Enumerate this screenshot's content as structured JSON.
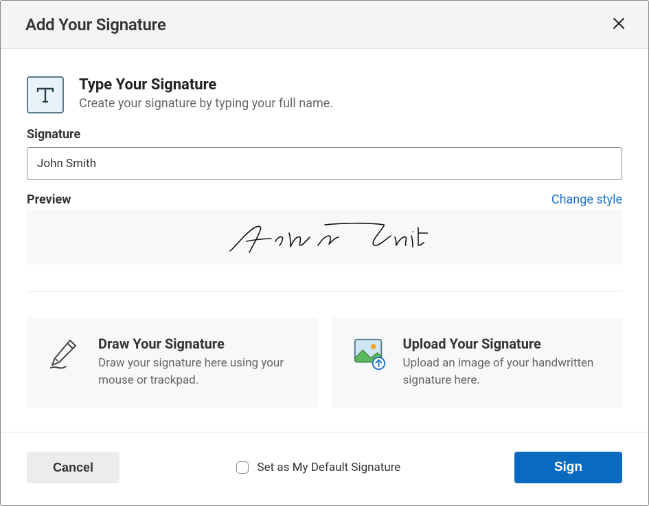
{
  "modal": {
    "title": "Add Your Signature"
  },
  "type_section": {
    "title": "Type Your Signature",
    "subtitle": "Create your signature by typing your full name.",
    "input_label": "Signature",
    "input_value": "John Smith",
    "preview_label": "Preview",
    "change_style_label": "Change style",
    "preview_text": "John Smith"
  },
  "draw_option": {
    "title": "Draw Your Signature",
    "subtitle": "Draw your signature here using your mouse or trackpad."
  },
  "upload_option": {
    "title": "Upload Your Signature",
    "subtitle": "Upload an image of your handwritten signature here."
  },
  "footer": {
    "cancel_label": "Cancel",
    "default_label": "Set as My Default Signature",
    "sign_label": "Sign"
  }
}
